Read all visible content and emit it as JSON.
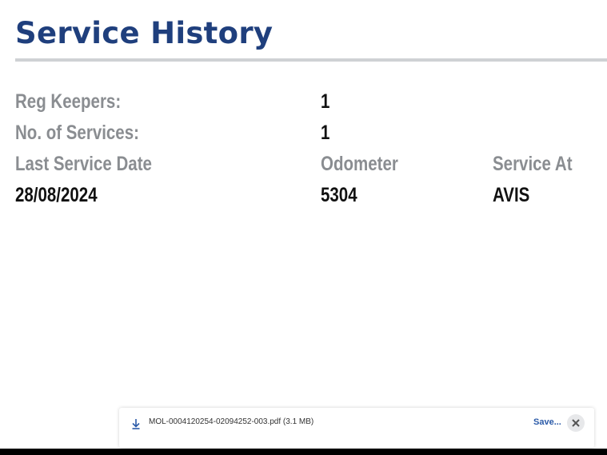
{
  "page": {
    "title": "Service History"
  },
  "details": {
    "reg_keepers_label": "Reg Keepers:",
    "reg_keepers_value": "1",
    "services_label": "No. of Services:",
    "services_value": "1"
  },
  "last_service": {
    "date_label": "Last Service Date",
    "date_value": "28/08/2024",
    "odometer_label": "Odometer",
    "odometer_value": "5304",
    "service_at_label": "Service At",
    "service_at_value": "AVIS"
  },
  "download": {
    "filename": "MOL-0004120254-02094252-003.pdf (3.1 MB)",
    "save_label": "Save...",
    "icon": "download-icon",
    "close_icon": "close-icon"
  },
  "colors": {
    "title": "#1f3f7d",
    "label": "#8a8d91",
    "value": "#111111",
    "link": "#2a5aa8"
  }
}
